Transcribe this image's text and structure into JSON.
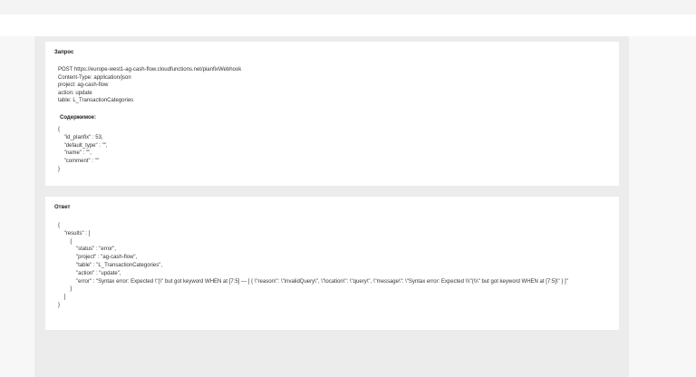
{
  "request": {
    "title": "Запрос",
    "lines": [
      "POST https://europe-west1-ag-cash-flow.cloudfunctions.net/planfixWebhook",
      "Content-Type: application/json",
      "project: ag-cash-flow",
      "action: update",
      "table: L_TransactionCategories"
    ],
    "body_title": "Содержимое:",
    "body_code": "{\n    \"id_planfix\" : 53,\n    \"default_type\" : \"\",\n    \"name\" : \"\",\n    \"comment\" : \"\"\n}"
  },
  "response": {
    "title": "Ответ",
    "body_code": "{\n    \"results\" : [\n        {\n            \"status\" : \"error\",\n            \"project\" : \"ag-cash-flow\",\n            \"table\" : \"L_TransactionCategories\",\n            \"action\" : \"update\",\n            \"error\" : \"Syntax error: Expected \\\"(\\\" but got keyword WHEN at [7:5] — [ { \\\"reason\\\": \\\"invalidQuery\\\", \\\"location\\\": \\\"query\\\", \\\"message\\\": \\\"Syntax error: Expected \\\\\\\"(\\\\\\\" but got keyword WHEN at [7:5]\\\" } ]\"\n        }\n    ]\n}"
  }
}
